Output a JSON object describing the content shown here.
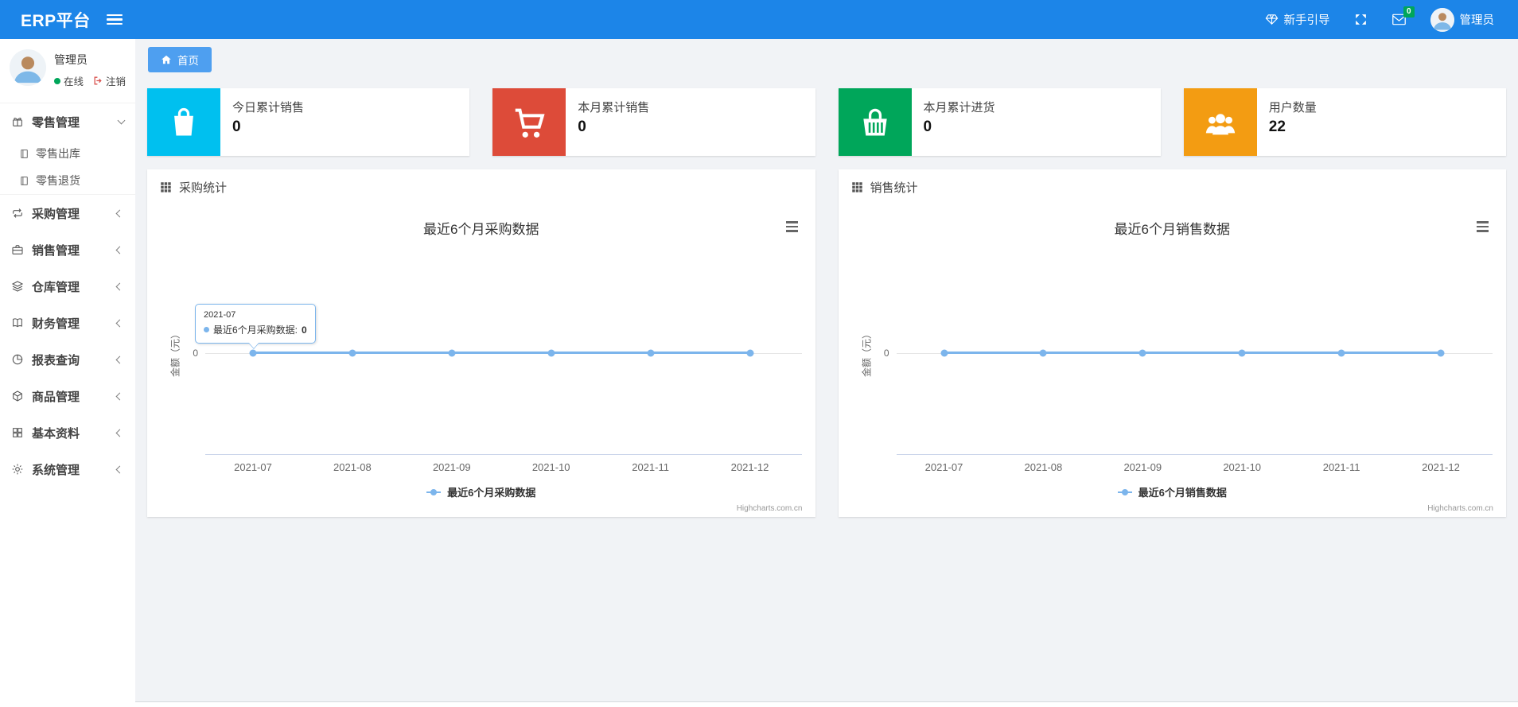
{
  "navbar": {
    "brand": "ERP平台",
    "guide_label": "新手引导",
    "mail_badge": "0",
    "user_name": "管理员"
  },
  "sidebar": {
    "user_name": "管理员",
    "status_online": "在线",
    "logout_label": "注销",
    "menu": [
      {
        "label": "零售管理",
        "icon": "gift-icon",
        "state": "expanded",
        "children": [
          {
            "label": "零售出库",
            "icon": "journal-icon"
          },
          {
            "label": "零售退货",
            "icon": "journal-icon"
          }
        ]
      },
      {
        "label": "采购管理",
        "icon": "repeat-icon",
        "state": "collapsed"
      },
      {
        "label": "销售管理",
        "icon": "briefcase-icon",
        "state": "collapsed"
      },
      {
        "label": "仓库管理",
        "icon": "layers-icon",
        "state": "collapsed"
      },
      {
        "label": "财务管理",
        "icon": "book-open-icon",
        "state": "collapsed"
      },
      {
        "label": "报表查询",
        "icon": "pie-chart-icon",
        "state": "collapsed"
      },
      {
        "label": "商品管理",
        "icon": "cube-icon",
        "state": "collapsed"
      },
      {
        "label": "基本资料",
        "icon": "grid-icon",
        "state": "collapsed"
      },
      {
        "label": "系统管理",
        "icon": "gear-icon",
        "state": "collapsed"
      }
    ]
  },
  "tabs": [
    {
      "label": "首页",
      "icon": "home-icon",
      "active": true
    }
  ],
  "cards": [
    {
      "label": "今日累计销售",
      "value": "0",
      "color": "#00c0ef",
      "icon": "shopping-bag-icon"
    },
    {
      "label": "本月累计销售",
      "value": "0",
      "color": "#dd4b39",
      "icon": "shopping-cart-icon"
    },
    {
      "label": "本月累计进货",
      "value": "0",
      "color": "#00a65a",
      "icon": "shopping-basket-icon"
    },
    {
      "label": "用户数量",
      "value": "22",
      "color": "#f39c12",
      "icon": "users-icon"
    }
  ],
  "panels": [
    {
      "title": "采购统计"
    },
    {
      "title": "销售统计"
    }
  ],
  "chart_data": [
    {
      "type": "line",
      "title": "最近6个月采购数据",
      "categories": [
        "2021-07",
        "2021-08",
        "2021-09",
        "2021-10",
        "2021-11",
        "2021-12"
      ],
      "series": [
        {
          "name": "最近6个月采购数据",
          "values": [
            0,
            0,
            0,
            0,
            0,
            0
          ]
        }
      ],
      "xlabel": "",
      "ylabel": "金额（元）",
      "yticks": [
        "0"
      ],
      "ylim": [
        0,
        0
      ],
      "grid": false,
      "legend_position": "bottom",
      "line_color": "#7cb5ec",
      "credits": "Highcharts.com.cn",
      "tooltip": {
        "header": "2021-07",
        "label": "最近6个月采购数据:",
        "value": "0"
      }
    },
    {
      "type": "line",
      "title": "最近6个月销售数据",
      "categories": [
        "2021-07",
        "2021-08",
        "2021-09",
        "2021-10",
        "2021-11",
        "2021-12"
      ],
      "series": [
        {
          "name": "最近6个月销售数据",
          "values": [
            0,
            0,
            0,
            0,
            0,
            0
          ]
        }
      ],
      "xlabel": "",
      "ylabel": "金额（元）",
      "yticks": [
        "0"
      ],
      "ylim": [
        0,
        0
      ],
      "grid": false,
      "legend_position": "bottom",
      "line_color": "#7cb5ec",
      "credits": "Highcharts.com.cn"
    }
  ],
  "colors": {
    "navbar": "#1c85e8",
    "tab": "#4e9ff0",
    "series": "#7cb5ec",
    "badge": "#00a65a",
    "online": "#00a65a"
  }
}
